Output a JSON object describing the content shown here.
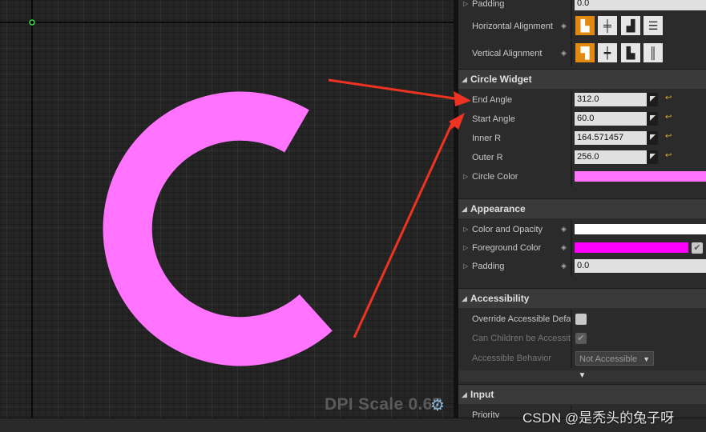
{
  "viewport": {
    "dpi_scale_text": "DPI Scale 0.67",
    "gear_icon": "gear-icon",
    "circle_color": "#ff73ff",
    "arrow_color": "#ee3322"
  },
  "panel": {
    "top_rows": {
      "padding_label": "Padding",
      "padding_value": "0.0",
      "horizontal_alignment_label": "Horizontal Alignment",
      "vertical_alignment_label": "Vertical Alignment"
    },
    "circle_widget": {
      "title": "Circle Widget",
      "end_angle_label": "End Angle",
      "end_angle_value": "312.0",
      "start_angle_label": "Start Angle",
      "start_angle_value": "60.0",
      "inner_r_label": "Inner R",
      "inner_r_value": "164.571457",
      "outer_r_label": "Outer R",
      "outer_r_value": "256.0",
      "circle_color_label": "Circle Color",
      "circle_color": "#ff73ff"
    },
    "appearance": {
      "title": "Appearance",
      "color_opacity_label": "Color and Opacity",
      "color_opacity": "#ffffff",
      "foreground_color_label": "Foreground Color",
      "foreground_color": "#ff00ff",
      "padding_label": "Padding",
      "padding_value": "0.0"
    },
    "accessibility": {
      "title": "Accessibility",
      "override_label": "Override Accessible Defa",
      "can_children_label": "Can Children be Accessit",
      "behavior_label": "Accessible Behavior",
      "behavior_value": "Not Accessible"
    },
    "input": {
      "title": "Input",
      "priority_label": "Priority"
    }
  },
  "watermark": "CSDN @是秃头的兔子呀"
}
